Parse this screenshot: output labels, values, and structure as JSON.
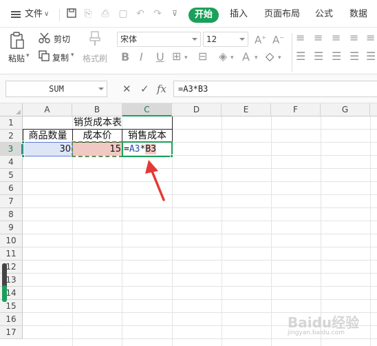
{
  "menu": {
    "file": "文件",
    "tabs": [
      "开始",
      "插入",
      "页面布局",
      "公式",
      "数据"
    ]
  },
  "ribbon": {
    "paste": "粘贴",
    "cut": "剪切",
    "copy": "复制",
    "format_painter": "格式刷",
    "font_name": "宋体",
    "font_size": "12"
  },
  "formula_bar": {
    "name_box": "SUM",
    "formula": "=A3*B3"
  },
  "columns": [
    "A",
    "B",
    "C",
    "D",
    "E",
    "F",
    "G"
  ],
  "rows": [
    "1",
    "2",
    "3",
    "4",
    "5",
    "6",
    "7",
    "8",
    "9",
    "10",
    "11",
    "12",
    "13",
    "14",
    "15",
    "16",
    "17"
  ],
  "sheet": {
    "title": "销货成本表",
    "headers": [
      "商品数量",
      "成本价",
      "销售成本"
    ],
    "a3": "30",
    "b3": "15",
    "c3": {
      "eq": "=",
      "ref_a": "A3",
      "op": "*",
      "ref_b": "B3"
    }
  },
  "watermark": {
    "brand": "Baidu经验",
    "url": "jingyan.baidu.com"
  },
  "colors": {
    "accent": "#1aa05a",
    "ref_a": "#1f4fa8",
    "ref_b_fill": "#f0c9c3",
    "a3_fill": "#dde6f7",
    "arrow": "#e53935"
  }
}
